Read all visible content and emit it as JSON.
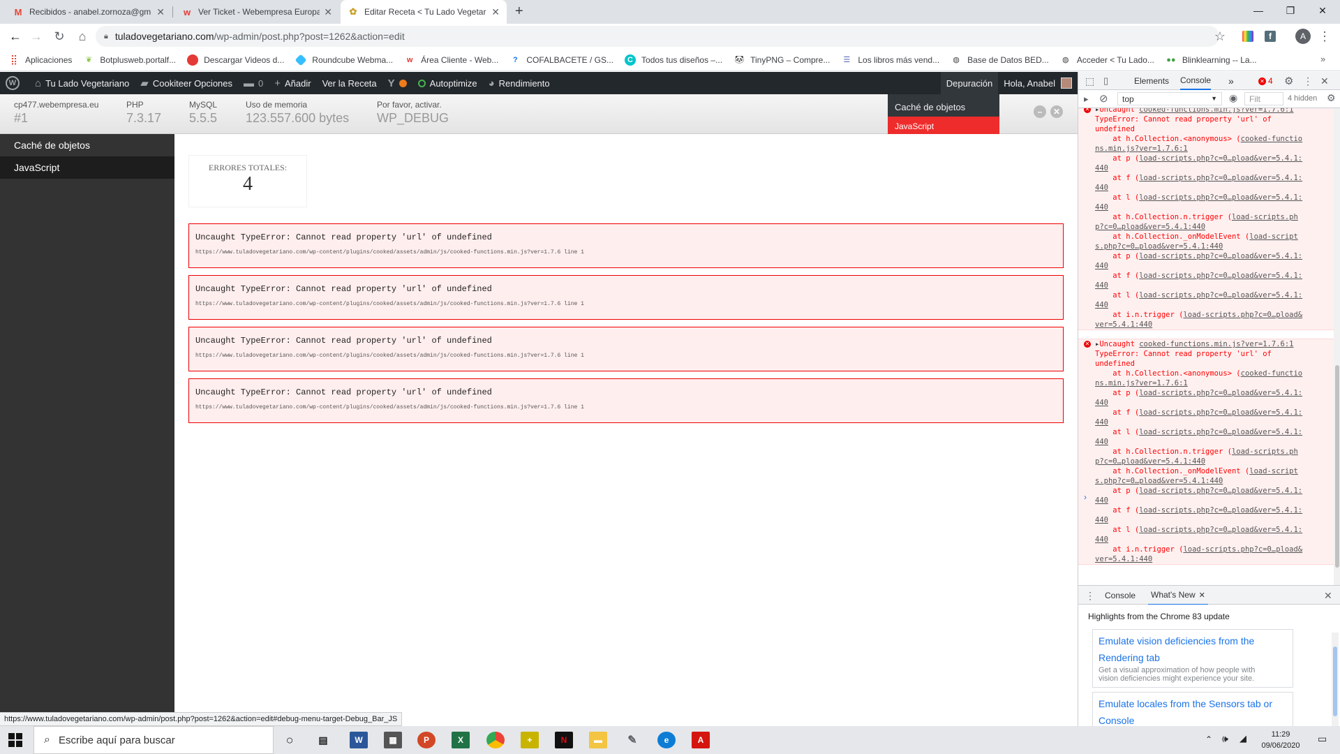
{
  "browser": {
    "tabs": [
      {
        "title": "Recibidos - anabel.zornoza@gm",
        "icon": "gmail-icon",
        "active": false
      },
      {
        "title": "Ver Ticket - Webempresa Europa",
        "icon": "webempresa-icon",
        "active": false
      },
      {
        "title": "Editar Receta < Tu Lado Vegetar",
        "icon": "site-icon",
        "active": true
      }
    ],
    "new_tab": "+",
    "address": {
      "host": "tuladovegetariano.com",
      "path": "/wp-admin/post.php?post=1262&action=edit"
    },
    "profile_initial": "A",
    "bookmarks": [
      {
        "label": "Aplicaciones",
        "icon": "apps-grid-icon",
        "color": "#ea4335"
      },
      {
        "label": "Botplusweb.portalf...",
        "icon": "leaf-icon",
        "color": "#8bc34a"
      },
      {
        "label": "Descargar Videos d...",
        "icon": "tomato-icon",
        "color": "#e53935"
      },
      {
        "label": "Roundcube Webma...",
        "icon": "roundcube-icon",
        "color": "#37beff"
      },
      {
        "label": "Área Cliente - Web...",
        "icon": "webempresa-icon",
        "color": "#e53935"
      },
      {
        "label": "COFALBACETE / GS...",
        "icon": "question-icon",
        "color": "#1a73e8"
      },
      {
        "label": "Todos tus diseños –...",
        "icon": "canva-icon",
        "color": "#00c4cc"
      },
      {
        "label": "TinyPNG – Compre...",
        "icon": "panda-icon",
        "color": "#555555"
      },
      {
        "label": "Los libros más vend...",
        "icon": "book-icon",
        "color": "#5c6bc0"
      },
      {
        "label": "Base de Datos BED...",
        "icon": "globe-icon",
        "color": "#444444"
      },
      {
        "label": "Acceder < Tu Lado...",
        "icon": "globe-icon",
        "color": "#444444"
      },
      {
        "label": "Blinklearning -- La...",
        "icon": "blink-icon",
        "color": "#43a047"
      }
    ],
    "status_url": "https://www.tuladovegetariano.com/wp-admin/post.php?post=1262&action=edit#debug-menu-target-Debug_Bar_JS"
  },
  "adminbar": {
    "site_name": "Tu Lado Vegetariano",
    "cookiteer": "Cookiteer Opciones",
    "comments_count": "0",
    "add_new": "Añadir",
    "view_recipe": "Ver la Receta",
    "autoptimize": "Autoptimize",
    "performance": "Rendimiento",
    "debug": "Depuración",
    "greeting": "Hola, Anabel"
  },
  "debugbar": {
    "stats": [
      {
        "label": "cp477.webempresa.eu",
        "value": "#1"
      },
      {
        "label": "PHP",
        "value": "7.3.17"
      },
      {
        "label": "MySQL",
        "value": "5.5.5"
      },
      {
        "label": "Uso de memoria",
        "value": "123.557.600 bytes"
      },
      {
        "label": "Por favor, activar.",
        "value": "WP_DEBUG"
      }
    ],
    "dropdown": [
      "Caché de objetos",
      "JavaScript"
    ],
    "sidebar": [
      "Caché de objetos",
      "JavaScript"
    ],
    "total_label": "ERRORES TOTALES:",
    "total_value": "4",
    "errors": [
      {
        "message": "Uncaught TypeError: Cannot read property 'url' of undefined",
        "source": "https://www.tuladovegetariano.com/wp-content/plugins/cooked/assets/admin/js/cooked-functions.min.js?ver=1.7.6 line 1"
      },
      {
        "message": "Uncaught TypeError: Cannot read property 'url' of undefined",
        "source": "https://www.tuladovegetariano.com/wp-content/plugins/cooked/assets/admin/js/cooked-functions.min.js?ver=1.7.6 line 1"
      },
      {
        "message": "Uncaught TypeError: Cannot read property 'url' of undefined",
        "source": "https://www.tuladovegetariano.com/wp-content/plugins/cooked/assets/admin/js/cooked-functions.min.js?ver=1.7.6 line 1"
      },
      {
        "message": "Uncaught TypeError: Cannot read property 'url' of undefined",
        "source": "https://www.tuladovegetariano.com/wp-content/plugins/cooked/assets/admin/js/cooked-functions.min.js?ver=1.7.6 line 1"
      }
    ]
  },
  "devtools": {
    "tabs": [
      "Elements",
      "Console"
    ],
    "more": "»",
    "error_count": "4",
    "context": "top",
    "filter_placeholder": "Filt",
    "hidden": "4 hidden",
    "console_lines": [
      [
        "",
        "Uncaught ",
        "cooked-functions.min.js?ver=1.7.6:1"
      ],
      [
        "",
        "TypeError: Cannot read property 'url' of",
        ""
      ],
      [
        "",
        "undefined",
        ""
      ],
      [
        "",
        "    at h.Collection.<anonymous> (",
        "cooked-functio"
      ],
      [
        "",
        "",
        "ns.min.js?ver=1.7.6:1"
      ],
      [
        "",
        "    at p (",
        "load-scripts.php?c=0…pload&ver=5.4.1:"
      ],
      [
        "",
        "",
        "440"
      ],
      [
        "",
        "    at f (",
        "load-scripts.php?c=0…pload&ver=5.4.1:"
      ],
      [
        "",
        "",
        "440"
      ],
      [
        "",
        "    at l (",
        "load-scripts.php?c=0…pload&ver=5.4.1:"
      ],
      [
        "",
        "",
        "440"
      ],
      [
        "",
        "    at h.Collection.n.trigger (",
        "load-scripts.ph"
      ],
      [
        "",
        "",
        "p?c=0…pload&ver=5.4.1:440"
      ],
      [
        "",
        "    at h.Collection._onModelEvent (",
        "load-script"
      ],
      [
        "",
        "",
        "s.php?c=0…pload&ver=5.4.1:440"
      ],
      [
        "",
        "    at p (",
        "load-scripts.php?c=0…pload&ver=5.4.1:"
      ],
      [
        "",
        "",
        "440"
      ],
      [
        "",
        "    at f (",
        "load-scripts.php?c=0…pload&ver=5.4.1:"
      ],
      [
        "",
        "",
        "440"
      ],
      [
        "",
        "    at l (",
        "load-scripts.php?c=0…pload&ver=5.4.1:"
      ],
      [
        "",
        "",
        "440"
      ],
      [
        "",
        "    at i.n.trigger (",
        "load-scripts.php?c=0…pload&"
      ],
      [
        "",
        "",
        "ver=5.4.1:440"
      ]
    ],
    "drawer_tabs": [
      "Console",
      "What's New"
    ],
    "highlights": "Highlights from the Chrome 83 update",
    "cards": [
      {
        "title_1": "Emulate vision deficiencies from the",
        "title_2": "Rendering tab",
        "desc_1": "Get a visual approximation of how people with",
        "desc_2": "vision deficiencies might experience your site."
      },
      {
        "title_1": "Emulate locales from the Sensors tab or",
        "title_2": "Console"
      }
    ]
  },
  "taskbar": {
    "search_placeholder": "Escribe aquí para buscar",
    "time": "11:29",
    "date": "09/06/2020"
  },
  "colors": {
    "wp_admin_bar": "#23282d",
    "debug_active": "#ee2c2c",
    "error_bg": "#ffeeee",
    "error_border": "#ee0000",
    "chrome_blue": "#1a73e8"
  }
}
